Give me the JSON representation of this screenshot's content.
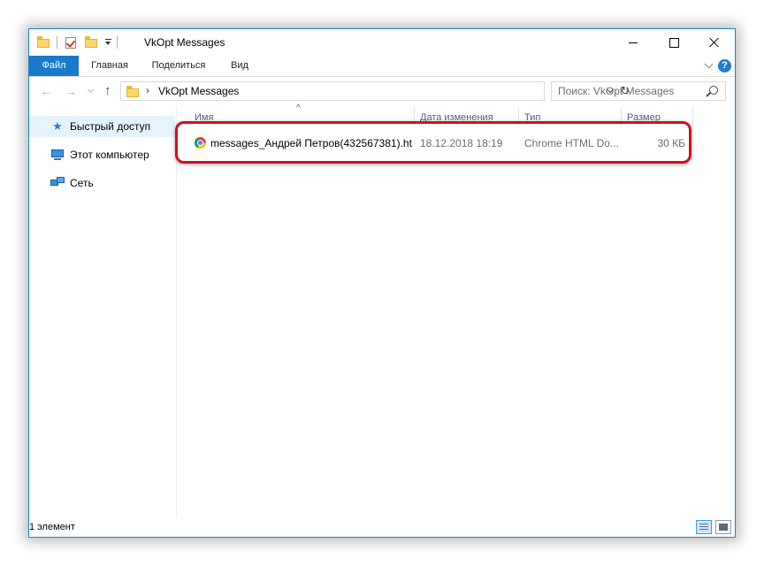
{
  "window": {
    "title": "VkOpt Messages",
    "controls": {
      "minimize": "minimize",
      "maximize": "maximize",
      "close": "close"
    }
  },
  "ribbon": {
    "tabs": [
      {
        "label": "Файл",
        "active": true
      },
      {
        "label": "Главная"
      },
      {
        "label": "Поделиться"
      },
      {
        "label": "Вид"
      }
    ],
    "help_label": "?"
  },
  "navigation": {
    "back": "←",
    "forward": "→",
    "up": "↑",
    "address_separator": "›",
    "address_path": "VkOpt Messages",
    "refresh": "↻",
    "search_placeholder": "Поиск: VkOpt Messages"
  },
  "sidebar": {
    "items": [
      {
        "label": "Быстрый доступ",
        "icon": "star-icon",
        "selected": true
      },
      {
        "label": "Этот компьютер",
        "icon": "computer-icon"
      },
      {
        "label": "Сеть",
        "icon": "network-icon"
      }
    ]
  },
  "file_list": {
    "columns": [
      "Имя",
      "Дата изменения",
      "Тип",
      "Размер"
    ],
    "sort_indicator": "^",
    "rows": [
      {
        "name": "messages_Андрей Петров(432567381).ht",
        "date": "18.12.2018 18:19",
        "type": "Chrome HTML Do...",
        "size": "30 КБ",
        "icon": "chrome-icon",
        "highlighted": true
      }
    ]
  },
  "status_bar": {
    "count": "1 элемент"
  },
  "colors": {
    "accent": "#1979ca",
    "highlight_border": "#d0101e",
    "selection": "#e5f3fb"
  }
}
